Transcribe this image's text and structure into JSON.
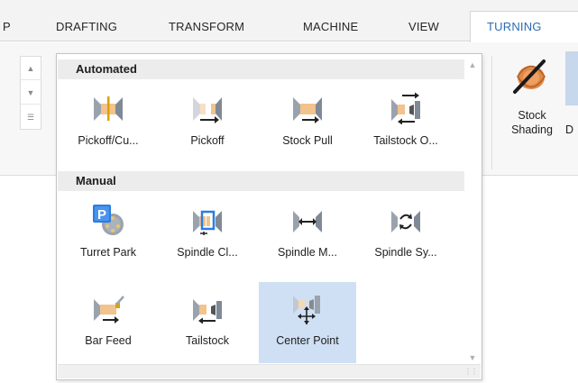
{
  "ribbon": {
    "tabs": [
      {
        "label": "P"
      },
      {
        "label": "DRAFTING"
      },
      {
        "label": "TRANSFORM"
      },
      {
        "label": "MACHINE"
      },
      {
        "label": "VIEW"
      },
      {
        "label": "TURNING",
        "active": true
      }
    ],
    "accent_color": "#2b6cb3",
    "stock_shading": {
      "label": "Stock\nShading",
      "icon": "stock-shading-icon"
    },
    "next_button": {
      "label": "D"
    }
  },
  "gallery": {
    "sections": [
      {
        "title": "Automated",
        "items": [
          {
            "label": "Pickoff/Cu...",
            "icon": "pickoff-cutoff-icon"
          },
          {
            "label": "Pickoff",
            "icon": "pickoff-icon"
          },
          {
            "label": "Stock Pull",
            "icon": "stock-pull-icon"
          },
          {
            "label": "Tailstock O...",
            "icon": "tailstock-operation-icon"
          }
        ]
      },
      {
        "title": "Manual",
        "items": [
          {
            "label": "Turret Park",
            "icon": "turret-park-icon"
          },
          {
            "label": "Spindle Cl...",
            "icon": "spindle-clamp-icon"
          },
          {
            "label": "Spindle M...",
            "icon": "spindle-move-icon"
          },
          {
            "label": "Spindle Sy...",
            "icon": "spindle-sync-icon"
          },
          {
            "label": "Bar Feed",
            "icon": "bar-feed-icon"
          },
          {
            "label": "Tailstock",
            "icon": "tailstock-icon"
          },
          {
            "label": "Center Point",
            "icon": "center-point-icon",
            "selected": true
          }
        ]
      }
    ],
    "selected_color": "#cfe0f4"
  }
}
